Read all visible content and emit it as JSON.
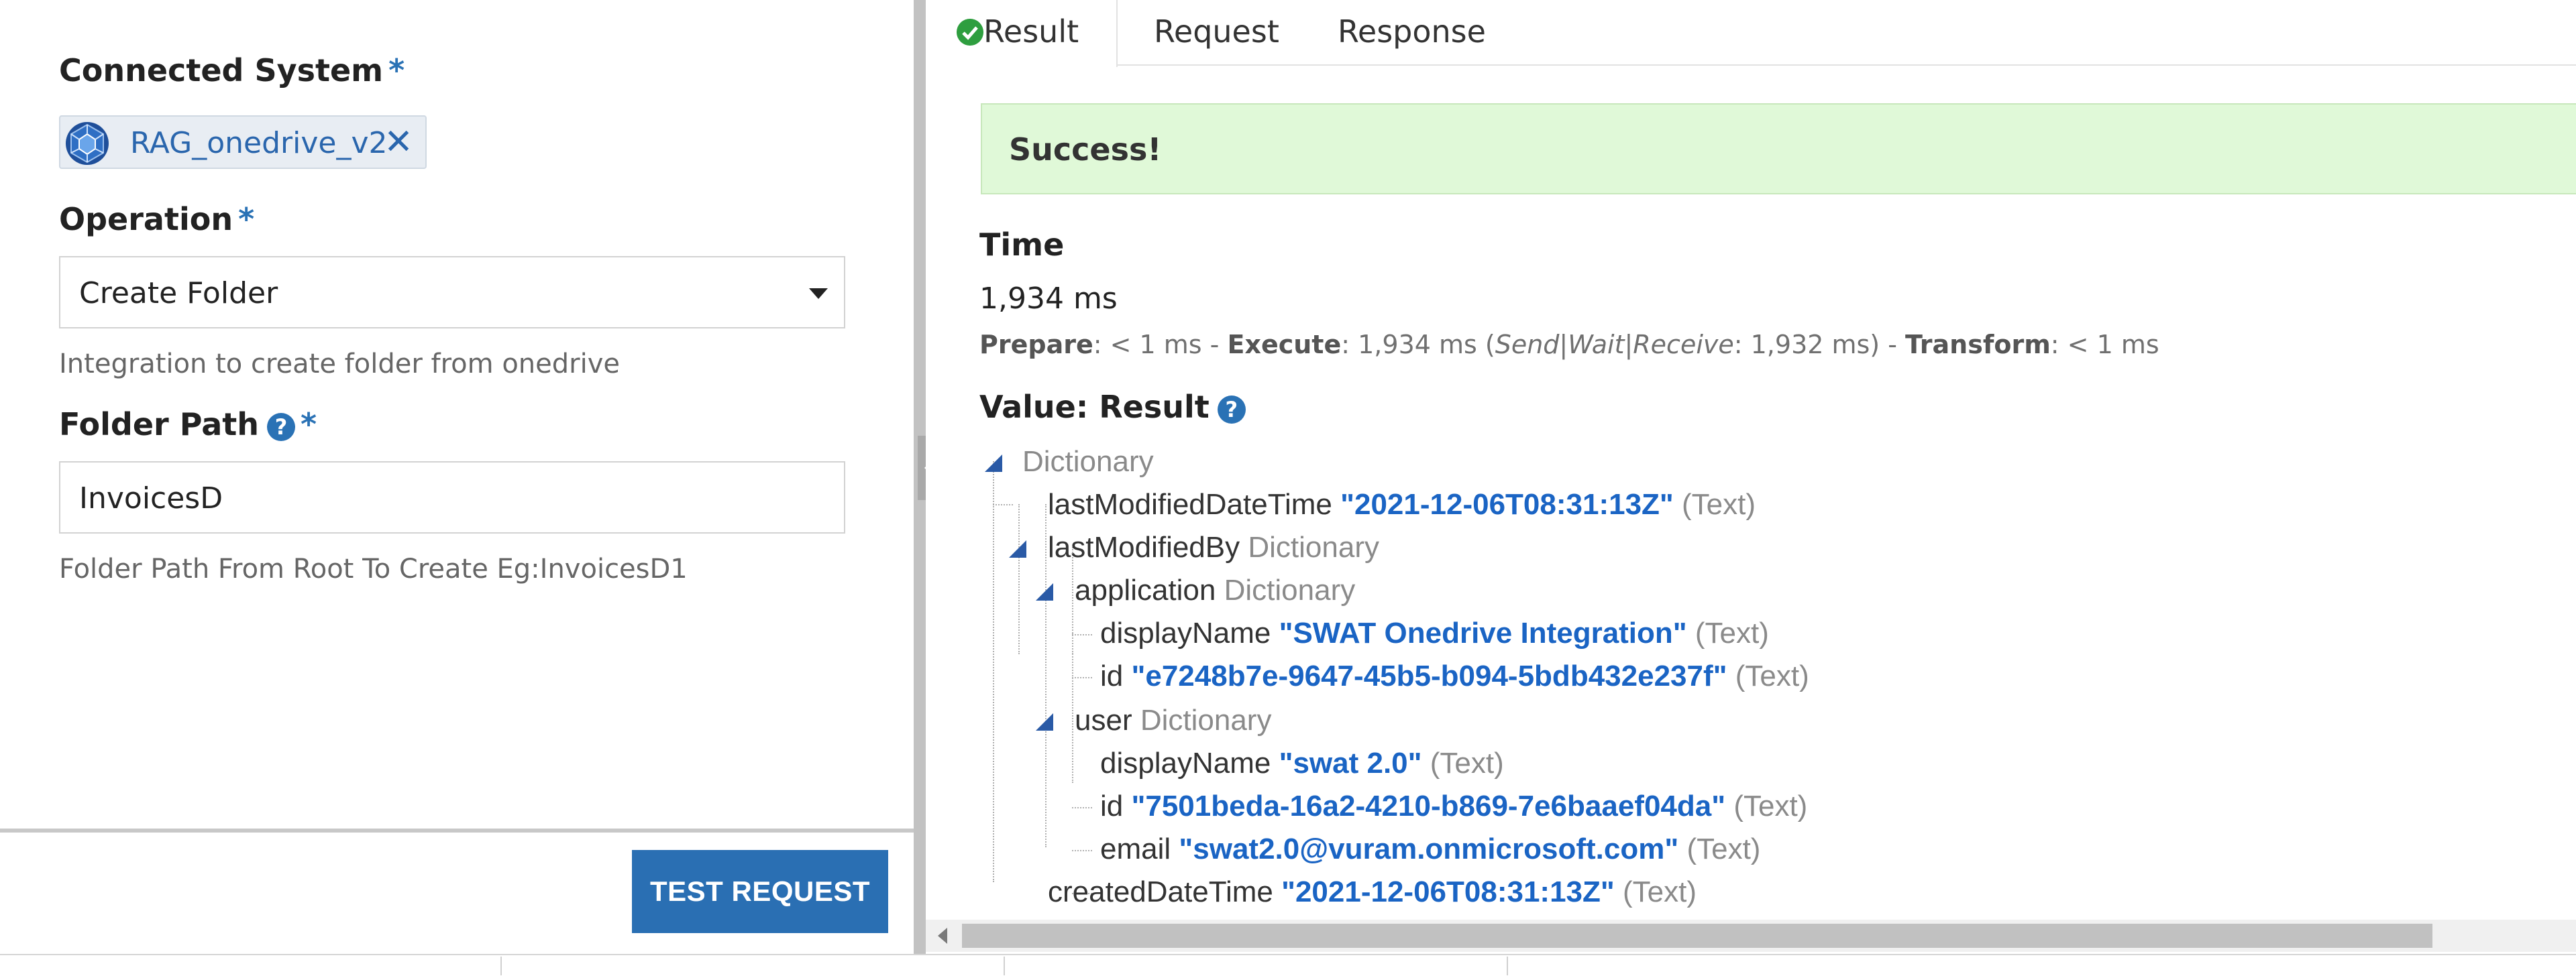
{
  "connected_system": {
    "label": "Connected System",
    "required_mark": "*",
    "chip_label": "RAG_onedrive_v2",
    "remove_icon": "close-icon"
  },
  "operation": {
    "label": "Operation",
    "required_mark": "*",
    "selected": "Create Folder",
    "description": "Integration to create folder from onedrive"
  },
  "folder_path": {
    "label": "Folder Path",
    "help": "?",
    "required_mark": "*",
    "value": "InvoicesD",
    "helper": "Folder Path From Root To Create Eg:InvoicesD1"
  },
  "test_button": {
    "label": "TEST REQUEST"
  },
  "tabs": [
    {
      "label": "Result",
      "icon": "check-circle-icon",
      "active": true
    },
    {
      "label": "Request",
      "active": false
    },
    {
      "label": "Response",
      "active": false
    }
  ],
  "result": {
    "banner": "Success!",
    "time_heading": "Time",
    "time_value": "1,934 ms",
    "breakdown": {
      "prepare_label": "Prepare",
      "prepare_value": ": < 1 ms - ",
      "execute_label": "Execute",
      "execute_value": ": 1,934 ms (",
      "swr_label": "Send|Wait|Receive",
      "swr_value": ": 1,932 ms) - ",
      "transform_label": "Transform",
      "transform_value": ": < 1 ms"
    },
    "value_heading": "Value: Result",
    "value_help": "?"
  },
  "tree": {
    "root_type": "Dictionary",
    "nodes": [
      {
        "key": "lastModifiedDateTime",
        "value": "\"2021-12-06T08:31:13Z\"",
        "kind": "(Text)"
      },
      {
        "key": "lastModifiedBy",
        "type": "Dictionary"
      },
      {
        "key": "application",
        "type": "Dictionary"
      },
      {
        "key": "displayName",
        "value": "\"SWAT Onedrive Integration\"",
        "kind": "(Text)"
      },
      {
        "key": "id",
        "value": "\"e7248b7e-9647-45b5-b094-5bdb432e237f\"",
        "kind": "(Text)"
      },
      {
        "key": "user",
        "type": "Dictionary"
      },
      {
        "key": "displayName",
        "value": "\"swat 2.0\"",
        "kind": "(Text)"
      },
      {
        "key": "id",
        "value": "\"7501beda-16a2-4210-b869-7e6baaef04da\"",
        "kind": "(Text)"
      },
      {
        "key": "email",
        "value": "\"swat2.0@vuram.onmicrosoft.com\"",
        "kind": "(Text)"
      },
      {
        "key": "createdDateTime",
        "value": "\"2021-12-06T08:31:13Z\"",
        "kind": "(Text)"
      }
    ]
  },
  "colors": {
    "accent": "#2a6fb3",
    "success_bg": "#e0f9d8",
    "value_blue": "#1a64c4",
    "type_gray": "#8a8a8a"
  }
}
